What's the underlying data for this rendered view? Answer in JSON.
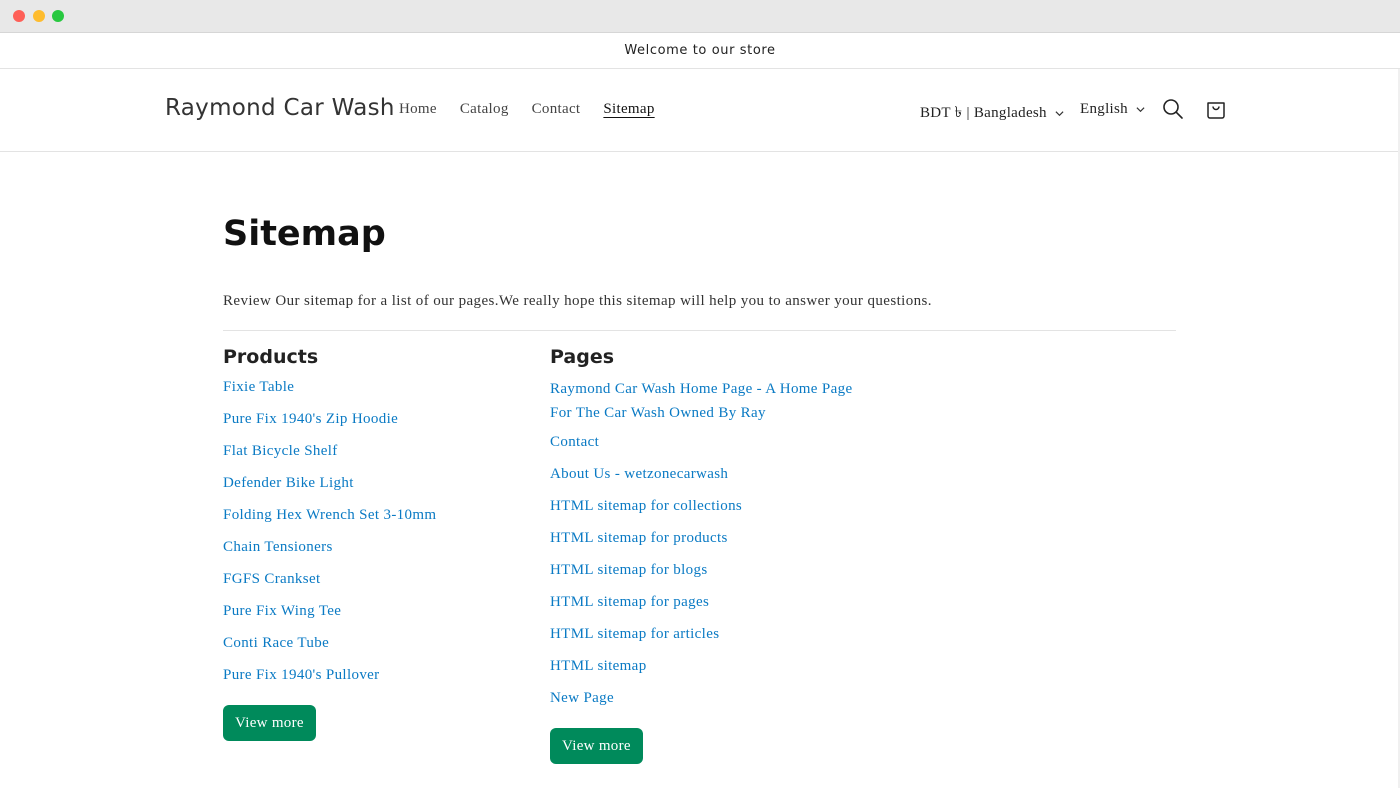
{
  "announcement": {
    "text": "Welcome to our store"
  },
  "header": {
    "logo": "Raymond Car Wash",
    "nav": [
      {
        "label": "Home"
      },
      {
        "label": "Catalog"
      },
      {
        "label": "Contact"
      },
      {
        "label": "Sitemap",
        "active": true
      }
    ],
    "currency": "BDT ৳ | Bangladesh",
    "language": "English"
  },
  "main": {
    "title": "Sitemap",
    "intro": "Review Our sitemap for a list of our pages.We really hope this sitemap will help you to answer your questions.",
    "products": {
      "heading": "Products",
      "items": [
        "Fixie Table",
        "Pure Fix 1940's Zip Hoodie",
        "Flat Bicycle Shelf",
        "Defender Bike Light",
        "Folding Hex Wrench Set 3-10mm",
        "Chain Tensioners",
        "FGFS Crankset",
        "Pure Fix Wing Tee",
        "Conti Race Tube",
        "Pure Fix 1940's Pullover"
      ],
      "view_more": "View more"
    },
    "pages": {
      "heading": "Pages",
      "items": [
        "Raymond Car Wash Home Page - A Home Page For The Car Wash Owned By Ray",
        "Contact",
        "About Us - wetzonecarwash",
        "HTML sitemap for collections",
        "HTML sitemap for products",
        "HTML sitemap for blogs",
        "HTML sitemap for pages",
        "HTML sitemap for articles",
        "HTML sitemap",
        "New Page"
      ],
      "view_more": "View more"
    }
  },
  "colors": {
    "link": "#0a7ac4",
    "button": "#008a5b"
  }
}
